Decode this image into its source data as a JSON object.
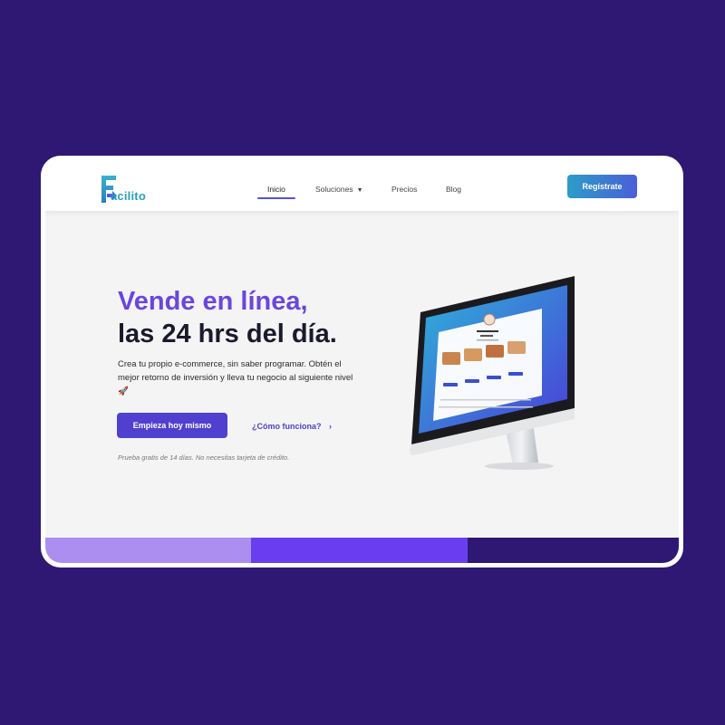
{
  "brand": {
    "name": "acilito",
    "logo_letter": "F",
    "colors": {
      "teal": "#2a9fbf",
      "purple": "#5040cf",
      "bg": "#2e1873"
    }
  },
  "nav": {
    "items": [
      {
        "label": "Inicio",
        "active": true
      },
      {
        "label": "Soluciones",
        "has_dropdown": true
      },
      {
        "label": "Precios"
      },
      {
        "label": "Blog"
      }
    ],
    "cta_label": "Regístrate"
  },
  "hero": {
    "title_line1": "Vende en línea,",
    "title_line2": "las 24 hrs del día.",
    "description": "Crea tu propio e-commerce, sin saber programar. Obtén el mejor retorno de inversión y lleva tu negocio al siguiente nivel 🚀",
    "primary_cta": "Empieza hoy mismo",
    "secondary_cta": "¿Cómo funciona?",
    "secondary_cta_icon": "chevron-right-icon",
    "fine_print": "Prueba gratis de 14 días. No necesitas tarjeta de crédito."
  },
  "mockup": {
    "store_name": "Fidel Pizzeria",
    "section": "Menú"
  }
}
